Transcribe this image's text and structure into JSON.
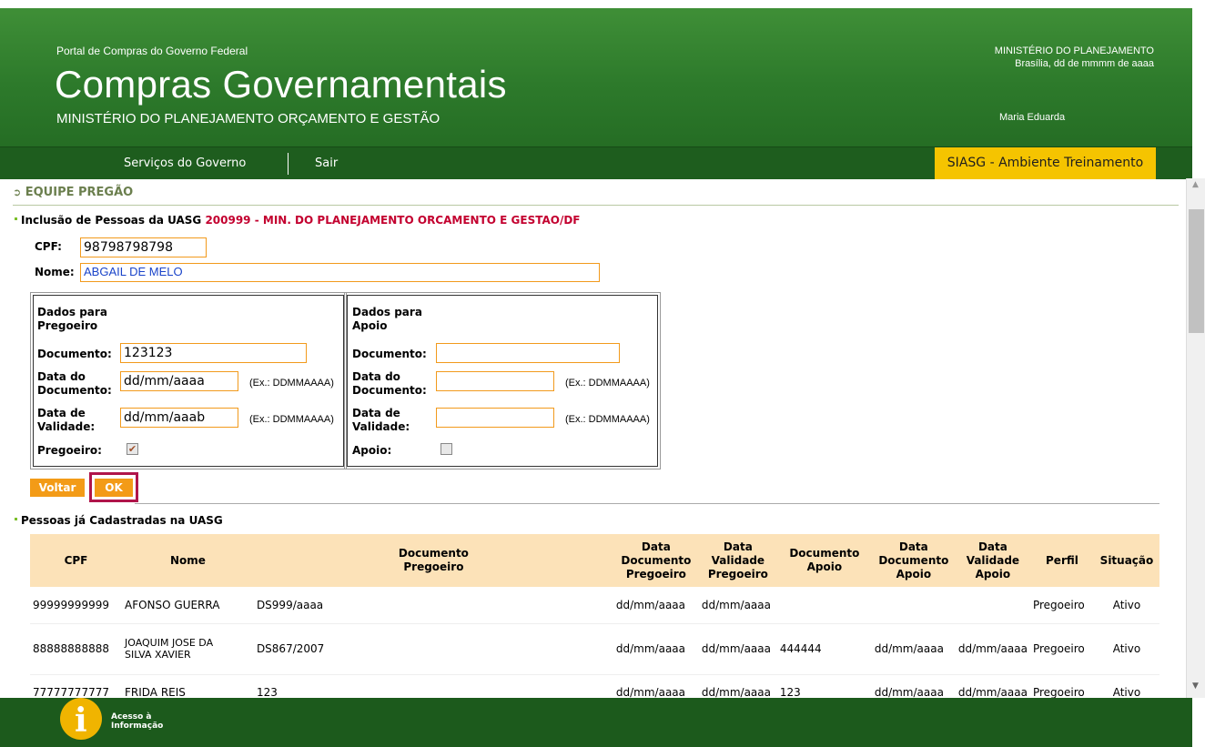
{
  "header": {
    "portal_label": "Portal de Compras do Governo Federal",
    "title": "Compras Governamentais",
    "subtitle": "MINISTÉRIO DO PLANEJAMENTO ORÇAMENTO E GESTÃO",
    "ministry": "MINISTÉRIO DO PLANEJAMENTO",
    "date": "Brasília, dd de mmmm de aaaa",
    "user": "Maria Eduarda"
  },
  "nav": {
    "services": "Serviços do Governo",
    "logout": "Sair",
    "environment": "SIASG - Ambiente Treinamento"
  },
  "page": {
    "section_title": "EQUIPE PREGÃO",
    "inclusion_label": "Inclusão de Pessoas da UASG",
    "uasg": "200999 - MIN. DO PLANEJAMENTO ORCAMENTO E GESTAO/DF",
    "cpf_label": "CPF:",
    "cpf_value": "98798798798",
    "nome_label": "Nome:",
    "nome_value": "ABGAIL DE MELO"
  },
  "pregoeiro": {
    "heading": "Dados para Pregoeiro",
    "documento_label": "Documento:",
    "documento_value": "123123",
    "data_doc_label": "Data do Documento:",
    "data_doc_value": "dd/mm/aaaa",
    "data_doc_hint": "(Ex.: DDMMAAAA)",
    "data_val_label": "Data de Validade:",
    "data_val_value": "dd/mm/aaab",
    "data_val_hint": "(Ex.: DDMMAAAA)",
    "check_label": "Pregoeiro:",
    "checked": true
  },
  "apoio": {
    "heading": "Dados para Apoio",
    "documento_label": "Documento:",
    "documento_value": "",
    "data_doc_label": "Data do Documento:",
    "data_doc_value": "",
    "data_doc_hint": "(Ex.: DDMMAAAA)",
    "data_val_label": "Data de Validade:",
    "data_val_value": "",
    "data_val_hint": "(Ex.: DDMMAAAA)",
    "check_label": "Apoio:",
    "checked": false
  },
  "buttons": {
    "back": "Voltar",
    "ok": "OK"
  },
  "list": {
    "title": "Pessoas já Cadastradas na UASG",
    "columns": [
      "CPF",
      "Nome",
      "Documento Pregoeiro",
      "Data Documento Pregoeiro",
      "Data Validade Pregoeiro",
      "Documento Apoio",
      "Data Documento Apoio",
      "Data Validade Apoio",
      "Perfil",
      "Situação"
    ],
    "rows": [
      [
        "99999999999",
        "AFONSO GUERRA",
        "DS999/aaaa",
        "dd/mm/aaaa",
        "dd/mm/aaaa",
        "",
        "",
        "",
        "Pregoeiro",
        "Ativo"
      ],
      [
        "88888888888",
        "JOAQUIM JOSE DA SILVA XAVIER",
        "DS867/2007",
        "dd/mm/aaaa",
        "dd/mm/aaaa",
        "444444",
        "dd/mm/aaaa",
        "dd/mm/aaaa",
        "Pregoeiro",
        "Ativo"
      ],
      [
        "77777777777",
        "FRIDA REIS",
        "123",
        "dd/mm/aaaa",
        "dd/mm/aaaa",
        "123",
        "dd/mm/aaaa",
        "dd/mm/aaaa",
        "Pregoeiro",
        "Ativo"
      ]
    ]
  },
  "footer": {
    "logo_text": "Acesso à Informação"
  }
}
